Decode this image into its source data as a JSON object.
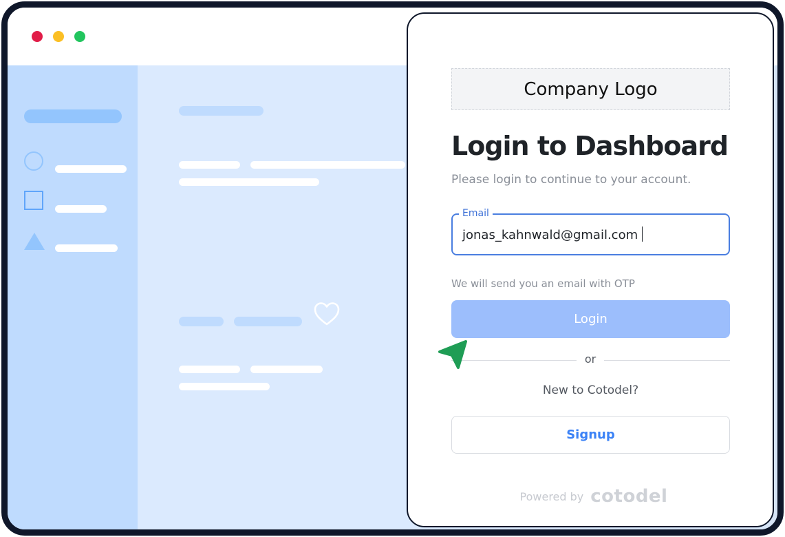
{
  "window": {
    "controls": [
      "close",
      "minimize",
      "maximize"
    ]
  },
  "background_app": {
    "icons": [
      "circle-icon",
      "square-icon",
      "triangle-icon",
      "heart-icon"
    ]
  },
  "login": {
    "logo_text": "Company Logo",
    "title": "Login to Dashboard",
    "subtitle": "Please login to continue to your account.",
    "email_label": "Email",
    "email_value": "jonas_kahnwald@gmail.com",
    "helper_text": "We will send you an email with OTP",
    "login_button": "Login",
    "divider_text": "or",
    "new_user_text": "New to Cotodel?",
    "signup_button": "Signup",
    "powered_by_label": "Powered by",
    "powered_by_brand": "cotodel"
  },
  "colors": {
    "accent": "#4a7ee0",
    "login_button_bg": "#9cbefc",
    "signup_text": "#3b82f6",
    "cursor": "#1f9d55"
  }
}
